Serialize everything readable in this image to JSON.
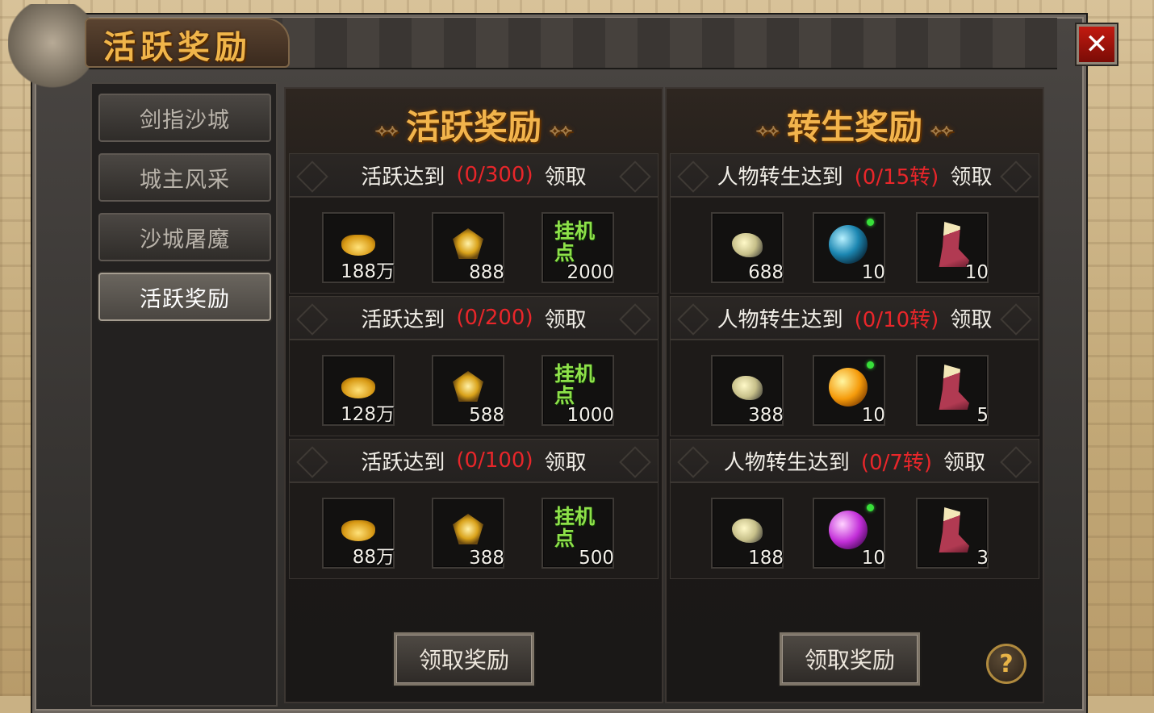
{
  "window": {
    "title": "活跃奖励",
    "close_label": "✕"
  },
  "sidebar": {
    "items": [
      {
        "label": "剑指沙城",
        "active": false
      },
      {
        "label": "城主风采",
        "active": false
      },
      {
        "label": "沙城屠魔",
        "active": false
      },
      {
        "label": "活跃奖励",
        "active": true
      }
    ]
  },
  "activity_panel": {
    "title": "活跃奖励",
    "claim_button": "领取奖励",
    "tiers": [
      {
        "label": "活跃达到",
        "progress": "(0/300)",
        "action": "领取",
        "rewards": [
          {
            "icon": "gold-ingot-icon",
            "qty": "188万"
          },
          {
            "icon": "medal-icon",
            "qty": "888"
          },
          {
            "icon": "afk-points-icon",
            "text": "挂机点",
            "qty": "2000"
          }
        ]
      },
      {
        "label": "活跃达到",
        "progress": "(0/200)",
        "action": "领取",
        "rewards": [
          {
            "icon": "gold-ingot-icon",
            "qty": "128万"
          },
          {
            "icon": "medal-icon",
            "qty": "588"
          },
          {
            "icon": "afk-points-icon",
            "text": "挂机点",
            "qty": "1000"
          }
        ]
      },
      {
        "label": "活跃达到",
        "progress": "(0/100)",
        "action": "领取",
        "rewards": [
          {
            "icon": "gold-ingot-icon",
            "qty": "88万"
          },
          {
            "icon": "medal-icon",
            "qty": "388"
          },
          {
            "icon": "afk-points-icon",
            "text": "挂机点",
            "qty": "500"
          }
        ]
      }
    ]
  },
  "rebirth_panel": {
    "title": "转生奖励",
    "claim_button": "领取奖励",
    "tiers": [
      {
        "label": "人物转生达到",
        "progress": "(0/15转)",
        "action": "领取",
        "rewards": [
          {
            "icon": "ore-stone-icon",
            "qty": "688"
          },
          {
            "icon": "blue-orb-icon",
            "qty": "10"
          },
          {
            "icon": "winged-boot-icon",
            "qty": "10"
          }
        ]
      },
      {
        "label": "人物转生达到",
        "progress": "(0/10转)",
        "action": "领取",
        "rewards": [
          {
            "icon": "ore-stone-icon",
            "qty": "388"
          },
          {
            "icon": "gold-orb-icon",
            "qty": "10"
          },
          {
            "icon": "winged-boot-icon",
            "qty": "5"
          }
        ]
      },
      {
        "label": "人物转生达到",
        "progress": "(0/7转)",
        "action": "领取",
        "rewards": [
          {
            "icon": "ore-stone-icon",
            "qty": "188"
          },
          {
            "icon": "purple-orb-icon",
            "qty": "10"
          },
          {
            "icon": "winged-boot-icon",
            "qty": "3"
          }
        ]
      }
    ]
  },
  "help_label": "?",
  "colors": {
    "title_gold": "#f2b44c",
    "progress_red": "#e8262a",
    "afk_green": "#8ee04a"
  }
}
